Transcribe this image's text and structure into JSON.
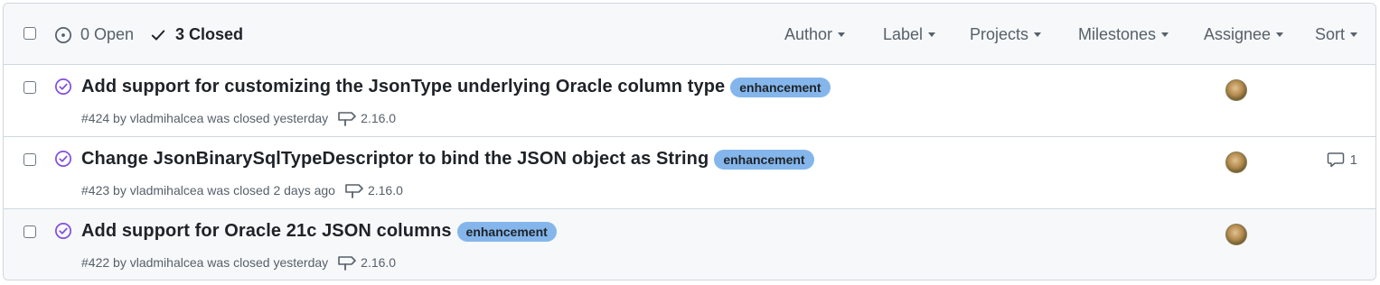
{
  "header": {
    "open_label": "0 Open",
    "closed_label": "3 Closed",
    "filters": [
      "Author",
      "Label",
      "Projects",
      "Milestones",
      "Assignee",
      "Sort"
    ]
  },
  "issues": [
    {
      "title": "Add support for customizing the JsonType underlying Oracle column type",
      "label": "enhancement",
      "meta": "#424 by vladmihalcea was closed yesterday",
      "milestone": "2.16.0",
      "comments": ""
    },
    {
      "title": "Change JsonBinarySqlTypeDescriptor to bind the JSON object as String",
      "label": "enhancement",
      "meta": "#423 by vladmihalcea was closed 2 days ago",
      "milestone": "2.16.0",
      "comments": "1"
    },
    {
      "title": "Add support for Oracle 21c JSON columns",
      "label": "enhancement",
      "meta": "#422 by vladmihalcea was closed yesterday",
      "milestone": "2.16.0",
      "comments": ""
    }
  ],
  "colors": {
    "closed_purple": "#8250df",
    "label_enhancement": "#84b6eb",
    "muted": "#57606a"
  },
  "icons": [
    "issue-opened-icon",
    "check-icon",
    "issue-closed-icon",
    "milestone-icon",
    "comment-icon",
    "caret-down-icon"
  ]
}
